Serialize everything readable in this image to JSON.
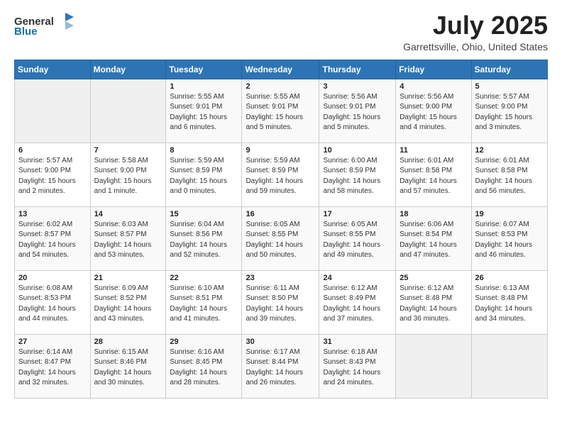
{
  "header": {
    "logo_general": "General",
    "logo_blue": "Blue",
    "title": "July 2025",
    "subtitle": "Garrettsville, Ohio, United States"
  },
  "calendar": {
    "weekdays": [
      "Sunday",
      "Monday",
      "Tuesday",
      "Wednesday",
      "Thursday",
      "Friday",
      "Saturday"
    ],
    "weeks": [
      [
        {
          "day": "",
          "info": ""
        },
        {
          "day": "",
          "info": ""
        },
        {
          "day": "1",
          "info": "Sunrise: 5:55 AM\nSunset: 9:01 PM\nDaylight: 15 hours and 6 minutes."
        },
        {
          "day": "2",
          "info": "Sunrise: 5:55 AM\nSunset: 9:01 PM\nDaylight: 15 hours and 5 minutes."
        },
        {
          "day": "3",
          "info": "Sunrise: 5:56 AM\nSunset: 9:01 PM\nDaylight: 15 hours and 5 minutes."
        },
        {
          "day": "4",
          "info": "Sunrise: 5:56 AM\nSunset: 9:00 PM\nDaylight: 15 hours and 4 minutes."
        },
        {
          "day": "5",
          "info": "Sunrise: 5:57 AM\nSunset: 9:00 PM\nDaylight: 15 hours and 3 minutes."
        }
      ],
      [
        {
          "day": "6",
          "info": "Sunrise: 5:57 AM\nSunset: 9:00 PM\nDaylight: 15 hours and 2 minutes."
        },
        {
          "day": "7",
          "info": "Sunrise: 5:58 AM\nSunset: 9:00 PM\nDaylight: 15 hours and 1 minute."
        },
        {
          "day": "8",
          "info": "Sunrise: 5:59 AM\nSunset: 8:59 PM\nDaylight: 15 hours and 0 minutes."
        },
        {
          "day": "9",
          "info": "Sunrise: 5:59 AM\nSunset: 8:59 PM\nDaylight: 14 hours and 59 minutes."
        },
        {
          "day": "10",
          "info": "Sunrise: 6:00 AM\nSunset: 8:59 PM\nDaylight: 14 hours and 58 minutes."
        },
        {
          "day": "11",
          "info": "Sunrise: 6:01 AM\nSunset: 8:58 PM\nDaylight: 14 hours and 57 minutes."
        },
        {
          "day": "12",
          "info": "Sunrise: 6:01 AM\nSunset: 8:58 PM\nDaylight: 14 hours and 56 minutes."
        }
      ],
      [
        {
          "day": "13",
          "info": "Sunrise: 6:02 AM\nSunset: 8:57 PM\nDaylight: 14 hours and 54 minutes."
        },
        {
          "day": "14",
          "info": "Sunrise: 6:03 AM\nSunset: 8:57 PM\nDaylight: 14 hours and 53 minutes."
        },
        {
          "day": "15",
          "info": "Sunrise: 6:04 AM\nSunset: 8:56 PM\nDaylight: 14 hours and 52 minutes."
        },
        {
          "day": "16",
          "info": "Sunrise: 6:05 AM\nSunset: 8:55 PM\nDaylight: 14 hours and 50 minutes."
        },
        {
          "day": "17",
          "info": "Sunrise: 6:05 AM\nSunset: 8:55 PM\nDaylight: 14 hours and 49 minutes."
        },
        {
          "day": "18",
          "info": "Sunrise: 6:06 AM\nSunset: 8:54 PM\nDaylight: 14 hours and 47 minutes."
        },
        {
          "day": "19",
          "info": "Sunrise: 6:07 AM\nSunset: 8:53 PM\nDaylight: 14 hours and 46 minutes."
        }
      ],
      [
        {
          "day": "20",
          "info": "Sunrise: 6:08 AM\nSunset: 8:53 PM\nDaylight: 14 hours and 44 minutes."
        },
        {
          "day": "21",
          "info": "Sunrise: 6:09 AM\nSunset: 8:52 PM\nDaylight: 14 hours and 43 minutes."
        },
        {
          "day": "22",
          "info": "Sunrise: 6:10 AM\nSunset: 8:51 PM\nDaylight: 14 hours and 41 minutes."
        },
        {
          "day": "23",
          "info": "Sunrise: 6:11 AM\nSunset: 8:50 PM\nDaylight: 14 hours and 39 minutes."
        },
        {
          "day": "24",
          "info": "Sunrise: 6:12 AM\nSunset: 8:49 PM\nDaylight: 14 hours and 37 minutes."
        },
        {
          "day": "25",
          "info": "Sunrise: 6:12 AM\nSunset: 8:48 PM\nDaylight: 14 hours and 36 minutes."
        },
        {
          "day": "26",
          "info": "Sunrise: 6:13 AM\nSunset: 8:48 PM\nDaylight: 14 hours and 34 minutes."
        }
      ],
      [
        {
          "day": "27",
          "info": "Sunrise: 6:14 AM\nSunset: 8:47 PM\nDaylight: 14 hours and 32 minutes."
        },
        {
          "day": "28",
          "info": "Sunrise: 6:15 AM\nSunset: 8:46 PM\nDaylight: 14 hours and 30 minutes."
        },
        {
          "day": "29",
          "info": "Sunrise: 6:16 AM\nSunset: 8:45 PM\nDaylight: 14 hours and 28 minutes."
        },
        {
          "day": "30",
          "info": "Sunrise: 6:17 AM\nSunset: 8:44 PM\nDaylight: 14 hours and 26 minutes."
        },
        {
          "day": "31",
          "info": "Sunrise: 6:18 AM\nSunset: 8:43 PM\nDaylight: 14 hours and 24 minutes."
        },
        {
          "day": "",
          "info": ""
        },
        {
          "day": "",
          "info": ""
        }
      ]
    ]
  }
}
